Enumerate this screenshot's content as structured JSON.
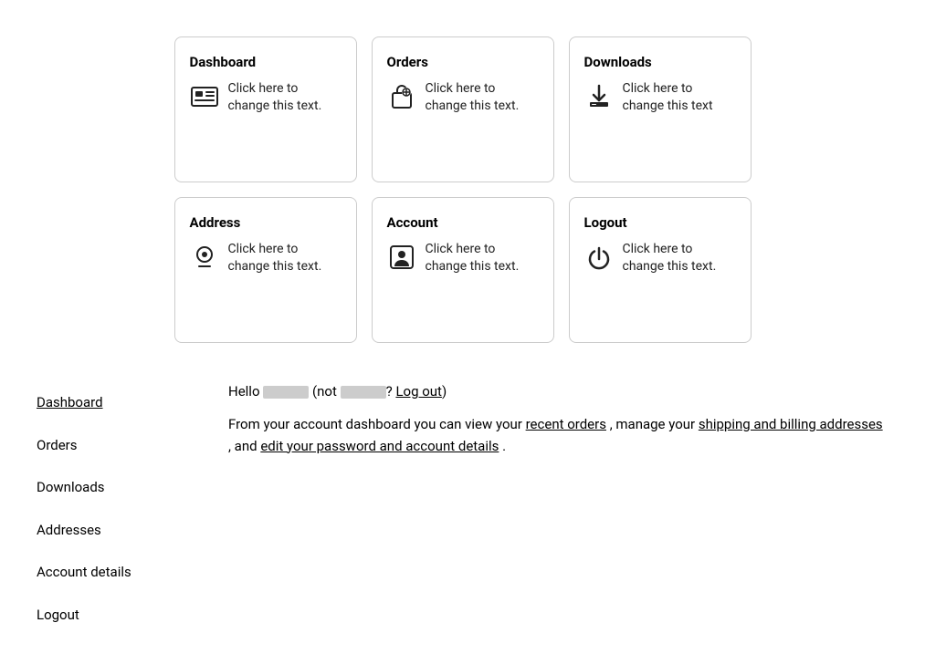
{
  "cards": [
    {
      "id": "dashboard",
      "title": "Dashboard",
      "text": "Click here to change this text.",
      "icon": "dashboard"
    },
    {
      "id": "orders",
      "title": "Orders",
      "text": "Click here to change this text.",
      "icon": "orders"
    },
    {
      "id": "downloads",
      "title": "Downloads",
      "text": "Click here to change this text",
      "icon": "downloads"
    },
    {
      "id": "address",
      "title": "Address",
      "text": "Click here to change this text.",
      "icon": "address"
    },
    {
      "id": "account",
      "title": "Account",
      "text": "Click here to change this text.",
      "icon": "account"
    },
    {
      "id": "logout",
      "title": "Logout",
      "text": "Click here to change this text.",
      "icon": "logout"
    }
  ],
  "sidebar": {
    "items": [
      {
        "label": "Dashboard",
        "href": "#",
        "active": true
      },
      {
        "label": "Orders",
        "href": "#",
        "active": false
      },
      {
        "label": "Downloads",
        "href": "#",
        "active": false
      },
      {
        "label": "Addresses",
        "href": "#",
        "active": false
      },
      {
        "label": "Account details",
        "href": "#",
        "active": false
      },
      {
        "label": "Logout",
        "href": "#",
        "active": false
      }
    ]
  },
  "hello": {
    "prefix": "Hello",
    "not_prefix": "(not",
    "suffix": "?",
    "logout_label": "Log out",
    "close_suffix": ")"
  },
  "description": {
    "text_before": "From your account dashboard you can view your",
    "link1": "recent orders",
    "text_mid1": ", manage your",
    "link2": "shipping and billing addresses",
    "text_mid2": ", and",
    "link3": "edit your password and account details",
    "text_end": "."
  }
}
